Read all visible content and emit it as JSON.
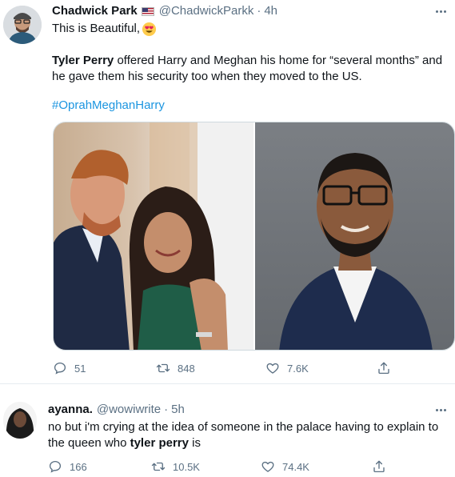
{
  "tweet": {
    "display_name": "Chadwick Park",
    "handle": "@ChadwickParkk",
    "separator": "·",
    "time": "4h",
    "line1": "This is Beautiful,",
    "emoji": "heart-eyes-emoji",
    "body_bold": "Tyler Perry",
    "body_line1_rest": " offered Harry and Meghan his home for “several months” and",
    "body_line2": "he gave them his security too when they moved to the US.",
    "hashtag": "#OprahMeghanHarry",
    "media": [
      "photo-harry-meghan",
      "photo-tyler-perry"
    ],
    "stats": {
      "replies": "51",
      "retweets": "848",
      "likes": "7.6K"
    }
  },
  "reply": {
    "display_name": "ayanna.",
    "handle": "@wowiwrite",
    "separator": "·",
    "time": "5h",
    "line1": "no but i'm crying at the idea of someone in the palace having to explain to",
    "line2_prefix": "the queen who ",
    "line2_bold": "tyler perry",
    "line2_suffix": " is",
    "stats": {
      "replies": "166",
      "retweets": "10.5K",
      "likes": "74.4K"
    }
  },
  "colors": {
    "text": "#0f1419",
    "muted": "#5b7083",
    "link": "#1b95e0",
    "divider": "#e6ecf0"
  }
}
